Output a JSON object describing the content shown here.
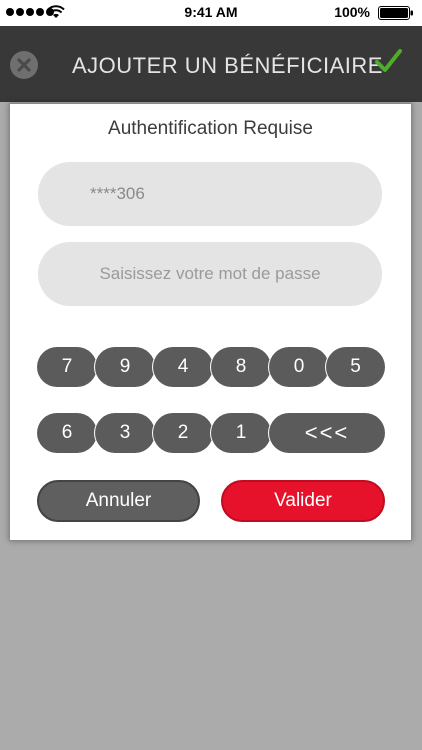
{
  "status_bar": {
    "time": "9:41 AM",
    "battery": "100%"
  },
  "header": {
    "title": "AJOUTER UN BÉNÉFICIAIRE"
  },
  "modal": {
    "title": "Authentification Requise",
    "account_value": "****306",
    "password_placeholder": "Saisissez votre mot de passe",
    "keypad_row1": [
      "7",
      "9",
      "4",
      "8",
      "0",
      "5"
    ],
    "keypad_row2": [
      "6",
      "3",
      "2",
      "1"
    ],
    "backspace_label": "<<<",
    "cancel_label": "Annuler",
    "validate_label": "Valider"
  },
  "colors": {
    "accent_red": "#e6112b",
    "check_green": "#4caf25",
    "key_gray": "#5b5b5b",
    "header_bg": "#4b4b4b"
  },
  "icons": {
    "signal": "signal-dots-icon",
    "wifi": "wifi-icon",
    "battery": "battery-icon",
    "close": "close-icon",
    "confirm": "check-icon"
  }
}
